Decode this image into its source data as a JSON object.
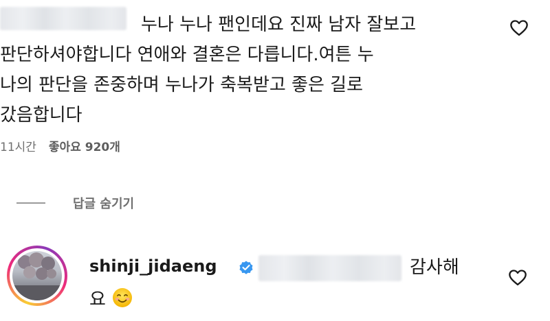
{
  "comment": {
    "line1": "누나 누나 팬인데요 진짜 남자 잘보고",
    "line2": "판단하셔야합니다 연애와 결혼은 다릅니다.여튼 누",
    "line3": "나의 판단을 존중하며 누나가 축복받고 좋은 길로",
    "line4": "갔음합니다",
    "time": "11시간",
    "likes": "좋아요 920개"
  },
  "thread": {
    "toggle_label": "답글 숨기기"
  },
  "reply": {
    "username": "shinji_jidaeng",
    "text_part1": "감사해",
    "text_part2": "요",
    "emoji": "smiling-face-emoji"
  },
  "icons": {
    "like": "heart-outline-icon",
    "verified": "verified-badge-icon",
    "verified_color": "#3897f0"
  }
}
